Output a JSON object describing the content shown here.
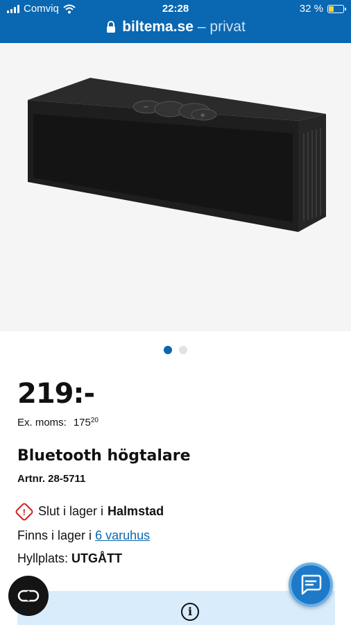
{
  "status_bar": {
    "carrier": "Comviq",
    "time": "22:28",
    "battery_percent": "32 %",
    "battery_level": 0.32,
    "battery_color": "#f4d43a"
  },
  "url_bar": {
    "host": "biltema.se",
    "suffix": "– privat"
  },
  "gallery": {
    "image_icon": "bluetooth-speaker-image",
    "slides": 2,
    "active_slide": 1
  },
  "product": {
    "price": "219:-",
    "ex_moms_label": "Ex. moms:",
    "ex_moms_value": "175",
    "ex_moms_cents": "20",
    "title": "Bluetooth högtalare",
    "artnr": "Artnr. 28-5711"
  },
  "stock": {
    "out_prefix": "Slut i lager i",
    "out_store": "Halmstad",
    "in_prefix": "Finns i lager i",
    "in_link": "6 varuhus",
    "shelf_label": "Hyllplats:",
    "shelf_value": "UTGÅTT"
  },
  "colors": {
    "brand": "#0a67b1",
    "warning": "#d42020",
    "info_bg": "#d8ecfb"
  },
  "icons": {
    "fab_left": "loop-icon",
    "fab_right": "chat-icon",
    "info": "info-icon"
  }
}
